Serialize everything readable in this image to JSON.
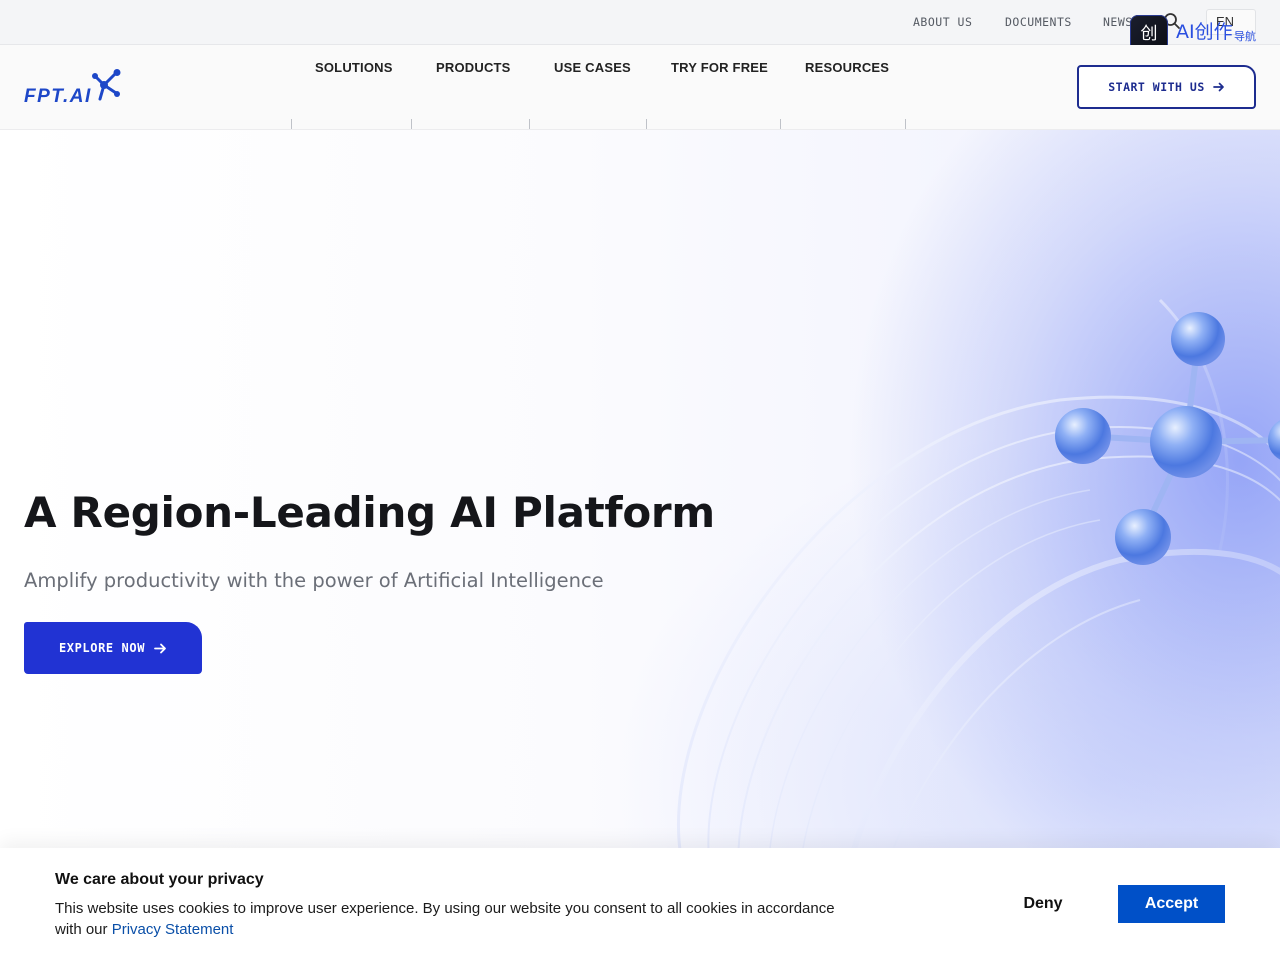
{
  "topbar": {
    "links": [
      "ABOUT US",
      "DOCUMENTS",
      "NEWS"
    ],
    "language": "EN",
    "promo_badge": {
      "icon_char": "创",
      "text": "AI创作",
      "subtext": "导航"
    }
  },
  "nav": {
    "items": [
      "SOLUTIONS",
      "PRODUCTS",
      "USE CASES",
      "TRY FOR FREE",
      "RESOURCES"
    ],
    "cta_label": "START WITH US"
  },
  "brand": {
    "logo_text": "FPT.AI",
    "accent_color": "#1d47c8"
  },
  "hero": {
    "title": "A Region-Leading AI Platform",
    "subtitle": "Amplify productivity with the power of Artificial Intelligence",
    "cta_label": "EXPLORE NOW"
  },
  "cookie": {
    "title": "We care about your privacy",
    "text": "This website uses cookies to improve user experience. By using our website you consent to all cookies in accordance with our ",
    "link_text": "Privacy Statement",
    "deny_label": "Deny",
    "accept_label": "Accept"
  },
  "colors": {
    "primary_button": "#2133d3",
    "accept_button": "#0050c8",
    "nav_outline": "#1d2c8f"
  }
}
